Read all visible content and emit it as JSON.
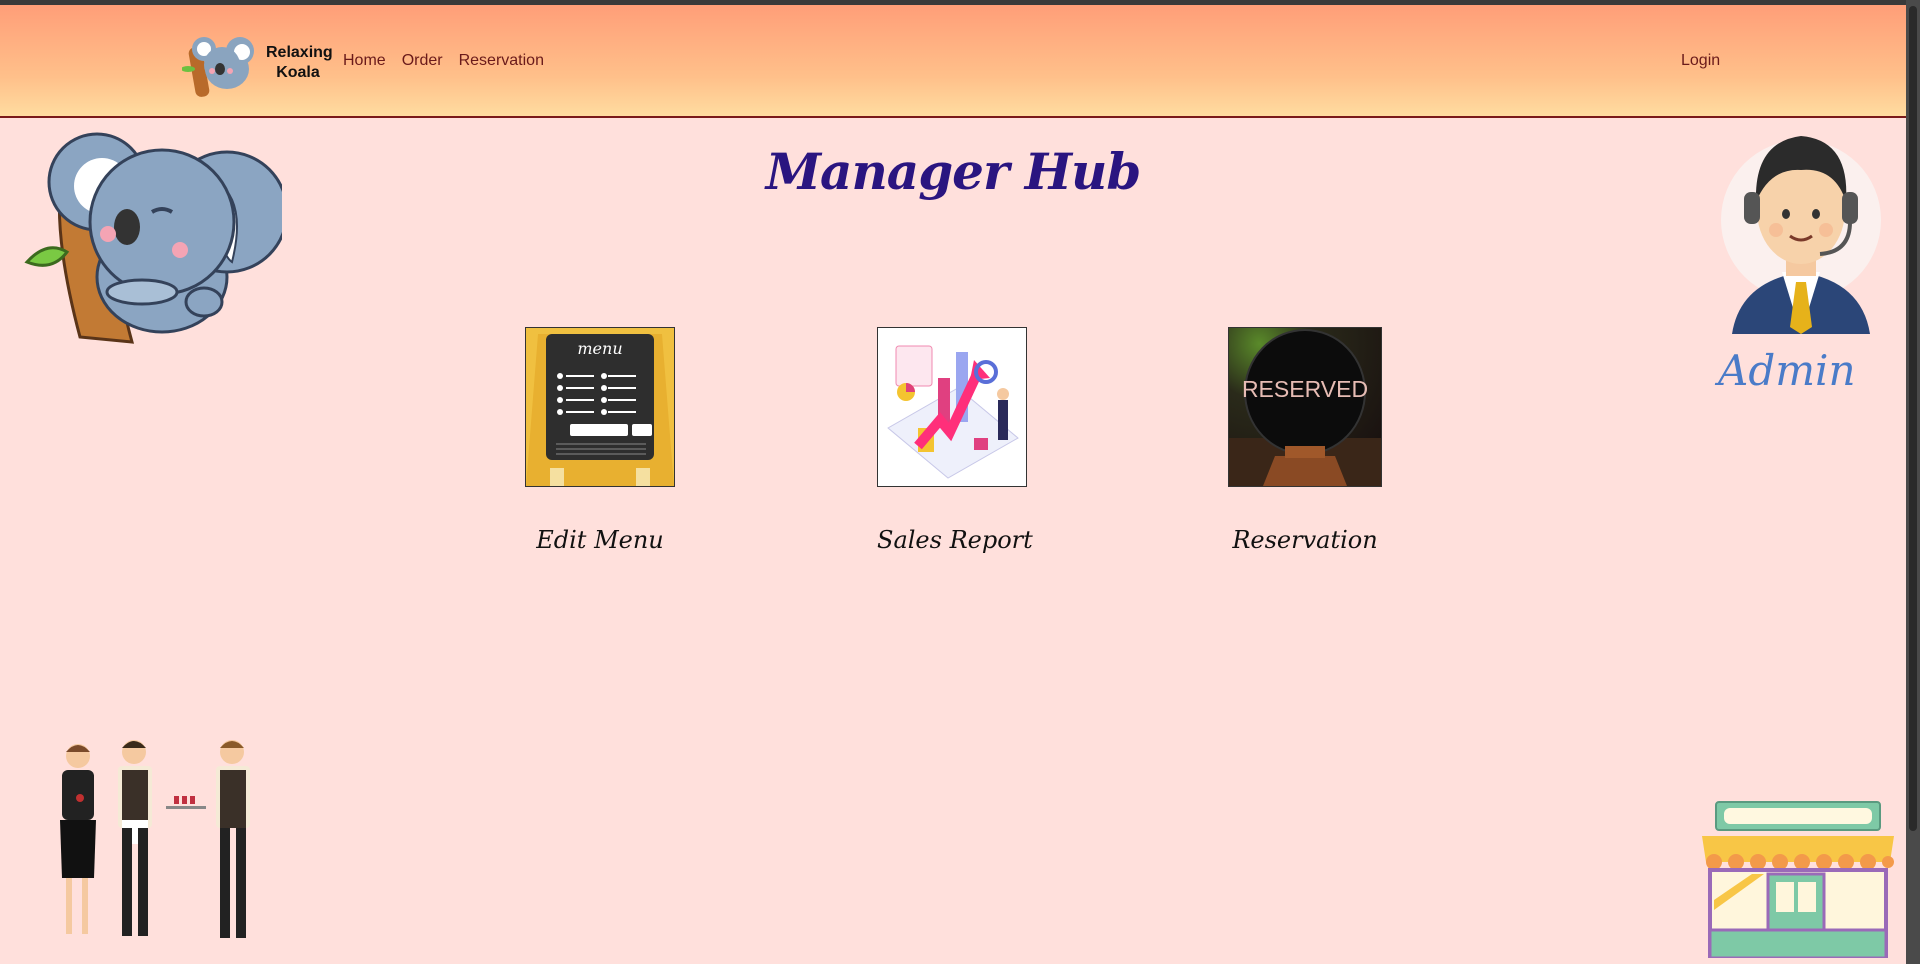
{
  "brand": {
    "name": "Relaxing Koala",
    "logo_icon": "koala-logo-icon"
  },
  "nav": {
    "items": [
      {
        "label": "Home"
      },
      {
        "label": "Order"
      },
      {
        "label": "Reservation"
      }
    ],
    "login_label": "Login"
  },
  "page": {
    "title": "Manager Hub",
    "admin_label": "Admin"
  },
  "cards": [
    {
      "label": "Edit Menu",
      "image_text": "menu",
      "icon": "menu-board-icon"
    },
    {
      "label": "Sales Report",
      "icon": "sales-chart-icon"
    },
    {
      "label": "Reservation",
      "image_text": "RESERVED",
      "icon": "reserved-sign-icon"
    }
  ],
  "colors": {
    "background": "#ffe0dc",
    "title": "#2a1580",
    "nav_link": "#6a1a1a",
    "admin": "#4a7bc8"
  }
}
